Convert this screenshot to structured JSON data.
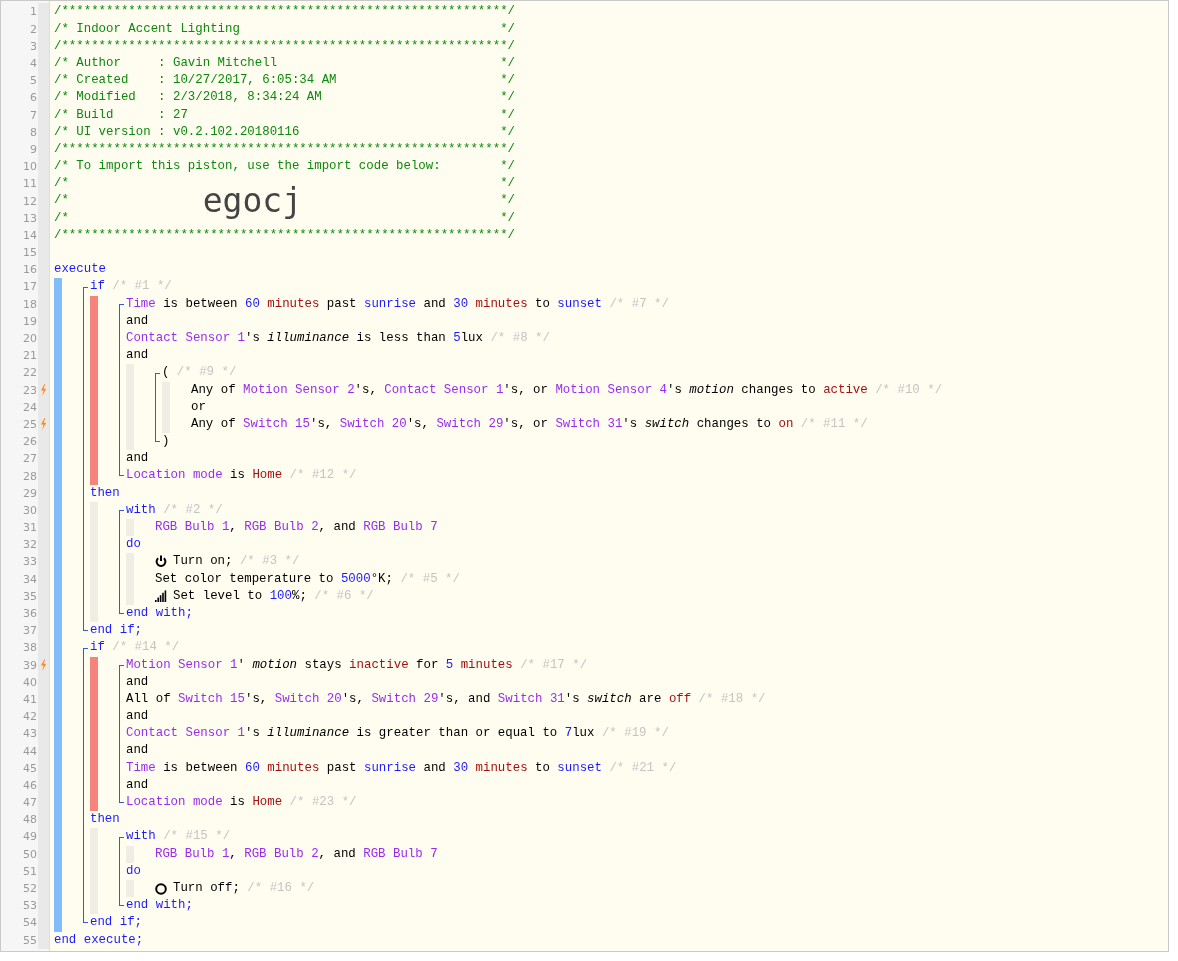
{
  "gutter": [
    {
      "number": "1",
      "trigger": false
    },
    {
      "number": "2",
      "trigger": false
    },
    {
      "number": "3",
      "trigger": false
    },
    {
      "number": "4",
      "trigger": false
    },
    {
      "number": "5",
      "trigger": false
    },
    {
      "number": "6",
      "trigger": false
    },
    {
      "number": "7",
      "trigger": false
    },
    {
      "number": "8",
      "trigger": false
    },
    {
      "number": "9",
      "trigger": false
    },
    {
      "number": "10",
      "trigger": false
    },
    {
      "number": "11",
      "trigger": false
    },
    {
      "number": "12",
      "trigger": false
    },
    {
      "number": "13",
      "trigger": false
    },
    {
      "number": "14",
      "trigger": false
    },
    {
      "number": "15",
      "trigger": false
    },
    {
      "number": "16",
      "trigger": false
    },
    {
      "number": "17",
      "trigger": false
    },
    {
      "number": "18",
      "trigger": false
    },
    {
      "number": "19",
      "trigger": false
    },
    {
      "number": "20",
      "trigger": false
    },
    {
      "number": "21",
      "trigger": false
    },
    {
      "number": "22",
      "trigger": false
    },
    {
      "number": "23",
      "trigger": true
    },
    {
      "number": "24",
      "trigger": false
    },
    {
      "number": "25",
      "trigger": true
    },
    {
      "number": "26",
      "trigger": false
    },
    {
      "number": "27",
      "trigger": false
    },
    {
      "number": "28",
      "trigger": false
    },
    {
      "number": "29",
      "trigger": false
    },
    {
      "number": "30",
      "trigger": false
    },
    {
      "number": "31",
      "trigger": false
    },
    {
      "number": "32",
      "trigger": false
    },
    {
      "number": "33",
      "trigger": false
    },
    {
      "number": "34",
      "trigger": false
    },
    {
      "number": "35",
      "trigger": false
    },
    {
      "number": "36",
      "trigger": false
    },
    {
      "number": "37",
      "trigger": false
    },
    {
      "number": "38",
      "trigger": false
    },
    {
      "number": "39",
      "trigger": true
    },
    {
      "number": "40",
      "trigger": false
    },
    {
      "number": "41",
      "trigger": false
    },
    {
      "number": "42",
      "trigger": false
    },
    {
      "number": "43",
      "trigger": false
    },
    {
      "number": "44",
      "trigger": false
    },
    {
      "number": "45",
      "trigger": false
    },
    {
      "number": "46",
      "trigger": false
    },
    {
      "number": "47",
      "trigger": false
    },
    {
      "number": "48",
      "trigger": false
    },
    {
      "number": "49",
      "trigger": false
    },
    {
      "number": "50",
      "trigger": false
    },
    {
      "number": "51",
      "trigger": false
    },
    {
      "number": "52",
      "trigger": false
    },
    {
      "number": "53",
      "trigger": false
    },
    {
      "number": "54",
      "trigger": false
    },
    {
      "number": "55",
      "trigger": false
    }
  ],
  "header": [
    {
      "kind": "comment",
      "text": "/************************************************************/"
    },
    {
      "kind": "comment",
      "text": "/* Indoor Accent Lighting",
      "end": "*/"
    },
    {
      "kind": "comment",
      "text": "/************************************************************/"
    },
    {
      "kind": "comment",
      "text": "/* Author     : Gavin Mitchell",
      "end": "*/"
    },
    {
      "kind": "comment",
      "text": "/* Created    : 10/27/2017, 6:05:34 AM",
      "end": "*/"
    },
    {
      "kind": "comment",
      "text": "/* Modified   : 2/3/2018, 8:34:24 AM",
      "end": "*/"
    },
    {
      "kind": "comment",
      "text": "/* Build      : 27",
      "end": "*/"
    },
    {
      "kind": "comment",
      "text": "/* UI version : v0.2.102.20180116",
      "end": "*/"
    },
    {
      "kind": "comment",
      "text": "/************************************************************/"
    },
    {
      "kind": "comment",
      "text": "/* To import this piston, use the import code below:",
      "end": "*/"
    },
    {
      "kind": "comment",
      "text": "/*",
      "end": "*/"
    },
    {
      "kind": "import_code",
      "text": "/*",
      "code": "egocj",
      "end": "*/"
    },
    {
      "kind": "comment",
      "text": "/*",
      "end": "*/"
    },
    {
      "kind": "comment",
      "text": "/************************************************************/"
    }
  ],
  "code": [
    {
      "kind": "line",
      "tokens": [
        {
          "kind": "kw",
          "text": "execute"
        }
      ]
    },
    {
      "kind": "execute_block",
      "children": [
        {
          "kind": "if_block",
          "children": [
            {
              "kind": "line",
              "tokens": [
                {
                  "kind": "kw",
                  "text": "if"
                },
                {
                  "kind": "cmt",
                  "text": " /* #1 */"
                }
              ]
            },
            {
              "kind": "condition_block",
              "children": [
                {
                  "kind": "line",
                  "tokens": [
                    {
                      "kind": "dev",
                      "text": "Time"
                    },
                    {
                      "kind": "txt",
                      "text": " is between "
                    },
                    {
                      "kind": "val",
                      "text": "60"
                    },
                    {
                      "kind": "unit",
                      "text": " minutes"
                    },
                    {
                      "kind": "txt",
                      "text": " past "
                    },
                    {
                      "kind": "val",
                      "text": "sunrise"
                    },
                    {
                      "kind": "txt",
                      "text": " and "
                    },
                    {
                      "kind": "val",
                      "text": "30"
                    },
                    {
                      "kind": "unit",
                      "text": " minutes"
                    },
                    {
                      "kind": "txt",
                      "text": " to "
                    },
                    {
                      "kind": "val",
                      "text": "sunset"
                    },
                    {
                      "kind": "cmt",
                      "text": " /* #7 */"
                    }
                  ]
                },
                {
                  "kind": "line",
                  "tokens": [
                    {
                      "kind": "txt",
                      "text": "and"
                    }
                  ]
                },
                {
                  "kind": "line",
                  "tokens": [
                    {
                      "kind": "dev",
                      "text": "Contact Sensor 1"
                    },
                    {
                      "kind": "txt",
                      "text": "'s "
                    },
                    {
                      "kind": "attr",
                      "text": "illuminance"
                    },
                    {
                      "kind": "txt",
                      "text": " is less than "
                    },
                    {
                      "kind": "val",
                      "text": "5"
                    },
                    {
                      "kind": "txt",
                      "text": "lux"
                    },
                    {
                      "kind": "cmt",
                      "text": " /* #8 */"
                    }
                  ]
                },
                {
                  "kind": "line",
                  "tokens": [
                    {
                      "kind": "txt",
                      "text": "and"
                    }
                  ]
                },
                {
                  "kind": "group_block",
                  "children": [
                    {
                      "kind": "line",
                      "tokens": [
                        {
                          "kind": "txt",
                          "text": "("
                        },
                        {
                          "kind": "cmt",
                          "text": " /* #9 */"
                        }
                      ]
                    },
                    {
                      "kind": "body_block",
                      "children": [
                        {
                          "kind": "line",
                          "tokens": [
                            {
                              "kind": "txt",
                              "text": "Any of "
                            },
                            {
                              "kind": "dev",
                              "text": "Motion Sensor 2"
                            },
                            {
                              "kind": "txt",
                              "text": "'s, "
                            },
                            {
                              "kind": "dev",
                              "text": "Contact Sensor 1"
                            },
                            {
                              "kind": "txt",
                              "text": "'s, or "
                            },
                            {
                              "kind": "dev",
                              "text": "Motion Sensor 4"
                            },
                            {
                              "kind": "txt",
                              "text": "'s "
                            },
                            {
                              "kind": "attr",
                              "text": "motion"
                            },
                            {
                              "kind": "txt",
                              "text": " changes to "
                            },
                            {
                              "kind": "unit",
                              "text": "active"
                            },
                            {
                              "kind": "cmt",
                              "text": " /* #10 */"
                            }
                          ]
                        },
                        {
                          "kind": "line",
                          "tokens": [
                            {
                              "kind": "txt",
                              "text": "or"
                            }
                          ]
                        },
                        {
                          "kind": "line",
                          "tokens": [
                            {
                              "kind": "txt",
                              "text": "Any of "
                            },
                            {
                              "kind": "dev",
                              "text": "Switch 15"
                            },
                            {
                              "kind": "txt",
                              "text": "'s, "
                            },
                            {
                              "kind": "dev",
                              "text": "Switch 20"
                            },
                            {
                              "kind": "txt",
                              "text": "'s, "
                            },
                            {
                              "kind": "dev",
                              "text": "Switch 29"
                            },
                            {
                              "kind": "txt",
                              "text": "'s, or "
                            },
                            {
                              "kind": "dev",
                              "text": "Switch 31"
                            },
                            {
                              "kind": "txt",
                              "text": "'s "
                            },
                            {
                              "kind": "attr",
                              "text": "switch"
                            },
                            {
                              "kind": "txt",
                              "text": " changes to "
                            },
                            {
                              "kind": "unit",
                              "text": "on"
                            },
                            {
                              "kind": "cmt",
                              "text": " /* #11 */"
                            }
                          ]
                        }
                      ]
                    },
                    {
                      "kind": "line",
                      "tokens": [
                        {
                          "kind": "txt",
                          "text": ")"
                        }
                      ]
                    }
                  ]
                },
                {
                  "kind": "line",
                  "tokens": [
                    {
                      "kind": "txt",
                      "text": "and"
                    }
                  ]
                },
                {
                  "kind": "line",
                  "tokens": [
                    {
                      "kind": "dev",
                      "text": "Location mode"
                    },
                    {
                      "kind": "txt",
                      "text": " is "
                    },
                    {
                      "kind": "unit",
                      "text": "Home"
                    },
                    {
                      "kind": "cmt",
                      "text": " /* #12 */"
                    }
                  ]
                }
              ]
            },
            {
              "kind": "line",
              "tokens": [
                {
                  "kind": "kw",
                  "text": "then"
                }
              ]
            },
            {
              "kind": "group_block",
              "children": [
                {
                  "kind": "line",
                  "tokens": [
                    {
                      "kind": "kw",
                      "text": "with"
                    },
                    {
                      "kind": "cmt",
                      "text": " /* #2 */"
                    }
                  ]
                },
                {
                  "kind": "body_block",
                  "children": [
                    {
                      "kind": "line",
                      "tokens": [
                        {
                          "kind": "dev",
                          "text": "RGB Bulb 1"
                        },
                        {
                          "kind": "txt",
                          "text": ", "
                        },
                        {
                          "kind": "dev",
                          "text": "RGB Bulb 2"
                        },
                        {
                          "kind": "txt",
                          "text": ", and "
                        },
                        {
                          "kind": "dev",
                          "text": "RGB Bulb 7"
                        }
                      ]
                    }
                  ]
                },
                {
                  "kind": "line",
                  "tokens": [
                    {
                      "kind": "kw",
                      "text": "do"
                    }
                  ]
                },
                {
                  "kind": "body_block",
                  "children": [
                    {
                      "kind": "on_command",
                      "tokens": [
                        {
                          "kind": "txt",
                          "text": "Turn on;"
                        },
                        {
                          "kind": "cmt",
                          "text": " /* #3 */"
                        }
                      ]
                    },
                    {
                      "kind": "line",
                      "tokens": [
                        {
                          "kind": "txt",
                          "text": "Set color temperature to "
                        },
                        {
                          "kind": "val",
                          "text": "5000"
                        },
                        {
                          "kind": "txt",
                          "text": "°K;"
                        },
                        {
                          "kind": "cmt",
                          "text": " /* #5 */"
                        }
                      ]
                    },
                    {
                      "kind": "level_command",
                      "tokens": [
                        {
                          "kind": "txt",
                          "text": "Set level to "
                        },
                        {
                          "kind": "val",
                          "text": "100"
                        },
                        {
                          "kind": "txt",
                          "text": "%;"
                        },
                        {
                          "kind": "cmt",
                          "text": " /* #6 */"
                        }
                      ]
                    }
                  ]
                },
                {
                  "kind": "line",
                  "tokens": [
                    {
                      "kind": "kw",
                      "text": "end with;"
                    }
                  ]
                }
              ]
            },
            {
              "kind": "line",
              "tokens": [
                {
                  "kind": "kw",
                  "text": "end if;"
                }
              ]
            }
          ]
        },
        {
          "kind": "if_block",
          "children": [
            {
              "kind": "line",
              "tokens": [
                {
                  "kind": "kw",
                  "text": "if"
                },
                {
                  "kind": "cmt",
                  "text": " /* #14 */"
                }
              ]
            },
            {
              "kind": "condition_block",
              "children": [
                {
                  "kind": "line",
                  "tokens": [
                    {
                      "kind": "dev",
                      "text": "Motion Sensor 1"
                    },
                    {
                      "kind": "txt",
                      "text": "' "
                    },
                    {
                      "kind": "attr",
                      "text": "motion"
                    },
                    {
                      "kind": "txt",
                      "text": " stays "
                    },
                    {
                      "kind": "unit",
                      "text": "inactive"
                    },
                    {
                      "kind": "txt",
                      "text": " for "
                    },
                    {
                      "kind": "val",
                      "text": "5"
                    },
                    {
                      "kind": "unit",
                      "text": " minutes"
                    },
                    {
                      "kind": "cmt",
                      "text": " /* #17 */"
                    }
                  ]
                },
                {
                  "kind": "line",
                  "tokens": [
                    {
                      "kind": "txt",
                      "text": "and"
                    }
                  ]
                },
                {
                  "kind": "line",
                  "tokens": [
                    {
                      "kind": "txt",
                      "text": "All of "
                    },
                    {
                      "kind": "dev",
                      "text": "Switch 15"
                    },
                    {
                      "kind": "txt",
                      "text": "'s, "
                    },
                    {
                      "kind": "dev",
                      "text": "Switch 20"
                    },
                    {
                      "kind": "txt",
                      "text": "'s, "
                    },
                    {
                      "kind": "dev",
                      "text": "Switch 29"
                    },
                    {
                      "kind": "txt",
                      "text": "'s, and "
                    },
                    {
                      "kind": "dev",
                      "text": "Switch 31"
                    },
                    {
                      "kind": "txt",
                      "text": "'s "
                    },
                    {
                      "kind": "attr",
                      "text": "switch"
                    },
                    {
                      "kind": "txt",
                      "text": " are "
                    },
                    {
                      "kind": "unit",
                      "text": "off"
                    },
                    {
                      "kind": "cmt",
                      "text": " /* #18 */"
                    }
                  ]
                },
                {
                  "kind": "line",
                  "tokens": [
                    {
                      "kind": "txt",
                      "text": "and"
                    }
                  ]
                },
                {
                  "kind": "line",
                  "tokens": [
                    {
                      "kind": "dev",
                      "text": "Contact Sensor 1"
                    },
                    {
                      "kind": "txt",
                      "text": "'s "
                    },
                    {
                      "kind": "attr",
                      "text": "illuminance"
                    },
                    {
                      "kind": "txt",
                      "text": " is greater than or equal to "
                    },
                    {
                      "kind": "val",
                      "text": "7"
                    },
                    {
                      "kind": "txt",
                      "text": "lux"
                    },
                    {
                      "kind": "cmt",
                      "text": " /* #19 */"
                    }
                  ]
                },
                {
                  "kind": "line",
                  "tokens": [
                    {
                      "kind": "txt",
                      "text": "and"
                    }
                  ]
                },
                {
                  "kind": "line",
                  "tokens": [
                    {
                      "kind": "dev",
                      "text": "Time"
                    },
                    {
                      "kind": "txt",
                      "text": " is between "
                    },
                    {
                      "kind": "val",
                      "text": "60"
                    },
                    {
                      "kind": "unit",
                      "text": " minutes"
                    },
                    {
                      "kind": "txt",
                      "text": " past "
                    },
                    {
                      "kind": "val",
                      "text": "sunrise"
                    },
                    {
                      "kind": "txt",
                      "text": " and "
                    },
                    {
                      "kind": "val",
                      "text": "30"
                    },
                    {
                      "kind": "unit",
                      "text": " minutes"
                    },
                    {
                      "kind": "txt",
                      "text": " to "
                    },
                    {
                      "kind": "val",
                      "text": "sunset"
                    },
                    {
                      "kind": "cmt",
                      "text": " /* #21 */"
                    }
                  ]
                },
                {
                  "kind": "line",
                  "tokens": [
                    {
                      "kind": "txt",
                      "text": "and"
                    }
                  ]
                },
                {
                  "kind": "line",
                  "tokens": [
                    {
                      "kind": "dev",
                      "text": "Location mode"
                    },
                    {
                      "kind": "txt",
                      "text": " is "
                    },
                    {
                      "kind": "unit",
                      "text": "Home"
                    },
                    {
                      "kind": "cmt",
                      "text": " /* #23 */"
                    }
                  ]
                }
              ]
            },
            {
              "kind": "line",
              "tokens": [
                {
                  "kind": "kw",
                  "text": "then"
                }
              ]
            },
            {
              "kind": "group_block",
              "children": [
                {
                  "kind": "line",
                  "tokens": [
                    {
                      "kind": "kw",
                      "text": "with"
                    },
                    {
                      "kind": "cmt",
                      "text": " /* #15 */"
                    }
                  ]
                },
                {
                  "kind": "body_block",
                  "children": [
                    {
                      "kind": "line",
                      "tokens": [
                        {
                          "kind": "dev",
                          "text": "RGB Bulb 1"
                        },
                        {
                          "kind": "txt",
                          "text": ", "
                        },
                        {
                          "kind": "dev",
                          "text": "RGB Bulb 2"
                        },
                        {
                          "kind": "txt",
                          "text": ", and "
                        },
                        {
                          "kind": "dev",
                          "text": "RGB Bulb 7"
                        }
                      ]
                    }
                  ]
                },
                {
                  "kind": "line",
                  "tokens": [
                    {
                      "kind": "kw",
                      "text": "do"
                    }
                  ]
                },
                {
                  "kind": "body_block",
                  "children": [
                    {
                      "kind": "off_command",
                      "tokens": [
                        {
                          "kind": "txt",
                          "text": "Turn off;"
                        },
                        {
                          "kind": "cmt",
                          "text": " /* #16 */"
                        }
                      ]
                    }
                  ]
                },
                {
                  "kind": "line",
                  "tokens": [
                    {
                      "kind": "kw",
                      "text": "end with;"
                    }
                  ]
                }
              ]
            },
            {
              "kind": "line",
              "tokens": [
                {
                  "kind": "kw",
                  "text": "end if;"
                }
              ]
            }
          ]
        }
      ]
    },
    {
      "kind": "line",
      "tokens": [
        {
          "kind": "kw",
          "text": "end execute;"
        }
      ]
    }
  ]
}
